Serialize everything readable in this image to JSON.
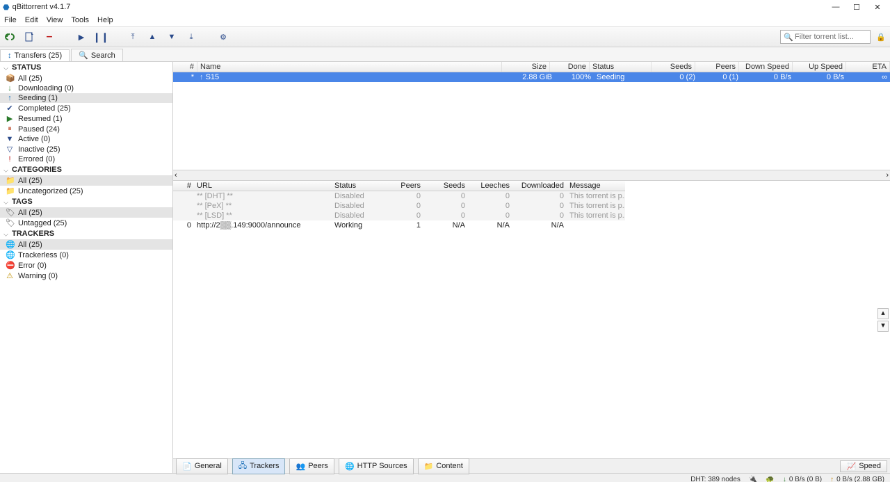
{
  "window": {
    "title": "qBittorrent v4.1.7",
    "controls": {
      "min": "—",
      "max": "☐",
      "close": "✕"
    }
  },
  "menu": [
    "File",
    "Edit",
    "View",
    "Tools",
    "Help"
  ],
  "filter": {
    "placeholder": "Filter torrent list..."
  },
  "tabs": {
    "transfers": "Transfers (25)",
    "search": "Search"
  },
  "sidebar": {
    "status": {
      "header": "STATUS",
      "items": [
        {
          "icon": "📦",
          "label": "All (25)",
          "name": "status-all"
        },
        {
          "icon": "↓",
          "label": "Downloading (0)",
          "name": "status-downloading",
          "color": "#2a7a2a"
        },
        {
          "icon": "↑",
          "label": "Seeding (1)",
          "name": "status-seeding",
          "selected": true,
          "color": "#1a6fb8"
        },
        {
          "icon": "✔",
          "label": "Completed (25)",
          "name": "status-completed",
          "color": "#2a4a8a"
        },
        {
          "icon": "▶",
          "label": "Resumed (1)",
          "name": "status-resumed",
          "color": "#2a7a2a"
        },
        {
          "icon": "⏸",
          "label": "Paused (24)",
          "name": "status-paused",
          "color": "#c05030"
        },
        {
          "icon": "▼",
          "label": "Active (0)",
          "name": "status-active",
          "color": "#2a4a8a"
        },
        {
          "icon": "▽",
          "label": "Inactive (25)",
          "name": "status-inactive",
          "color": "#2a4a8a"
        },
        {
          "icon": "!",
          "label": "Errored (0)",
          "name": "status-errored",
          "color": "#c02020"
        }
      ]
    },
    "categories": {
      "header": "CATEGORIES",
      "items": [
        {
          "icon": "📁",
          "label": "All (25)",
          "name": "cat-all",
          "selected": true
        },
        {
          "icon": "📁",
          "label": "Uncategorized (25)",
          "name": "cat-uncat"
        }
      ]
    },
    "tags": {
      "header": "TAGS",
      "items": [
        {
          "icon": "🏷",
          "label": "All (25)",
          "name": "tag-all",
          "selected": true
        },
        {
          "icon": "🏷",
          "label": "Untagged (25)",
          "name": "tag-untagged"
        }
      ]
    },
    "trackers": {
      "header": "TRACKERS",
      "items": [
        {
          "icon": "🌐",
          "label": "All (25)",
          "name": "trk-all",
          "selected": true,
          "color": "#2a4a8a"
        },
        {
          "icon": "🌐",
          "label": "Trackerless (0)",
          "name": "trk-less"
        },
        {
          "icon": "⛔",
          "label": "Error (0)",
          "name": "trk-error",
          "color": "#c02020"
        },
        {
          "icon": "⚠",
          "label": "Warning (0)",
          "name": "trk-warning",
          "color": "#c09000"
        }
      ]
    }
  },
  "transfers": {
    "headers": {
      "num": "#",
      "name": "Name",
      "size": "Size",
      "done": "Done",
      "status": "Status",
      "seeds": "Seeds",
      "peers": "Peers",
      "down": "Down Speed",
      "up": "Up Speed",
      "eta": "ETA"
    },
    "rows": [
      {
        "num": "*",
        "name": "S15",
        "size": "2.88 GiB",
        "done": "100%",
        "status": "Seeding",
        "seeds": "0 (2)",
        "peers": "0 (1)",
        "down": "0 B/s",
        "up": "0 B/s",
        "eta": "∞"
      }
    ]
  },
  "trackers_table": {
    "headers": {
      "n": "#",
      "url": "URL",
      "st": "Status",
      "pe": "Peers",
      "se": "Seeds",
      "le": "Leeches",
      "dl": "Downloaded",
      "msg": "Message"
    },
    "rows": [
      {
        "n": "",
        "url": "** [DHT] **",
        "st": "Disabled",
        "pe": "0",
        "se": "0",
        "le": "0",
        "dl": "0",
        "msg": "This torrent is p...",
        "dis": true
      },
      {
        "n": "",
        "url": "** [PeX] **",
        "st": "Disabled",
        "pe": "0",
        "se": "0",
        "le": "0",
        "dl": "0",
        "msg": "This torrent is p...",
        "dis": true
      },
      {
        "n": "",
        "url": "** [LSD] **",
        "st": "Disabled",
        "pe": "0",
        "se": "0",
        "le": "0",
        "dl": "0",
        "msg": "This torrent is p...",
        "dis": true
      },
      {
        "n": "0",
        "url": "http://2▒▒.149:9000/announce",
        "st": "Working",
        "pe": "1",
        "se": "N/A",
        "le": "N/A",
        "dl": "N/A",
        "msg": ""
      }
    ]
  },
  "bottom_tabs": {
    "general": "General",
    "trackers": "Trackers",
    "peers": "Peers",
    "http": "HTTP Sources",
    "content": "Content",
    "speed": "Speed"
  },
  "statusbar": {
    "dht": "DHT: 389 nodes",
    "down": "0 B/s (0 B)",
    "up": "0 B/s (2.88 GB)"
  }
}
